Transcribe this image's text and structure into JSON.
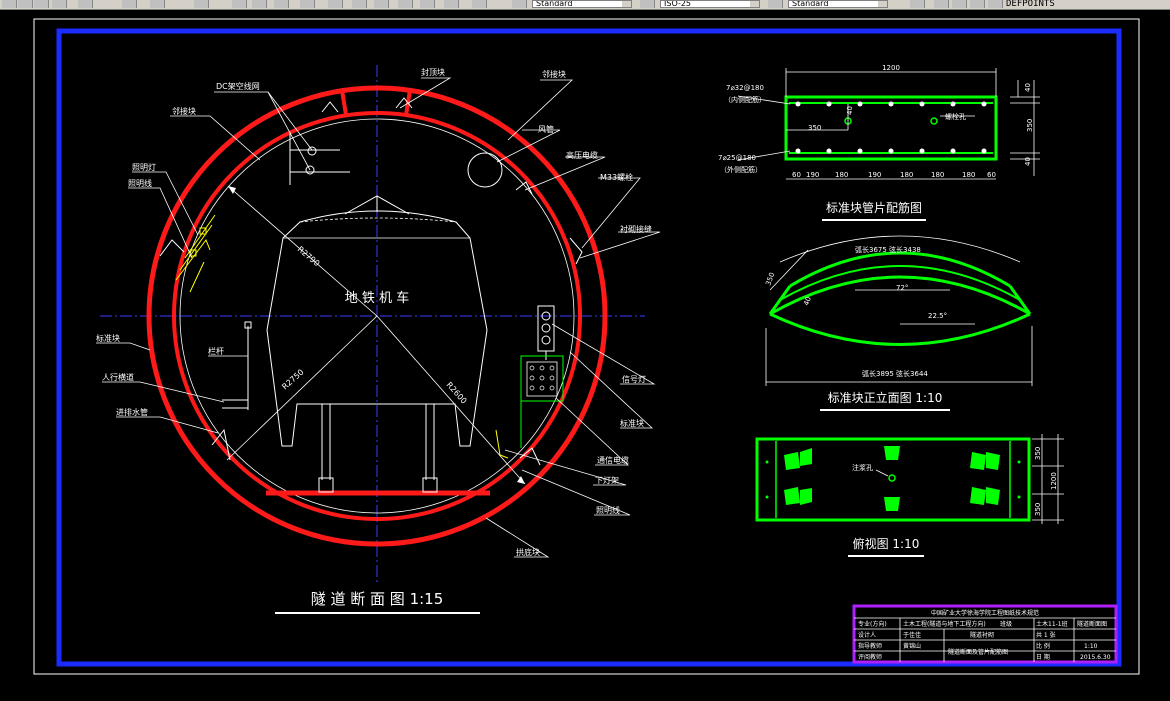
{
  "toolbar": {
    "text_style": "Standard",
    "dim_style": "ISO-25",
    "table_style": "Standard",
    "layer": "DEFPOINTS"
  },
  "drawing": {
    "tunnel": {
      "title": "隧 道 断 面 图 1:15",
      "vehicle": "地 铁 机 车",
      "labels": {
        "dc_net": "DC架空线网",
        "seal_top": "封顶块",
        "adj_top_left": "邻接块",
        "adj_top_right": "邻接块",
        "adj_left": "邻接块",
        "wind_pipe": "风管",
        "hv_cable": "高压电缆",
        "m33": "M33螺栓",
        "lighting_lamp": "照明灯",
        "lighting_line_left": "照明线",
        "lining": "衬砌接缝",
        "std_left": "标准块",
        "railing": "栏杆",
        "walkway": "人行横道",
        "drain": "进排水管",
        "signal": "信号灯",
        "std_right": "标准块",
        "comm_cable": "通信电缆",
        "lamp_rack": "下灯架",
        "lighting_line_right": "照明线",
        "bottom_block": "拱底块",
        "r2790": "R2790",
        "r2750": "R2750",
        "r2600": "R2600"
      }
    },
    "rebar": {
      "title": "标准块管片配筋图",
      "width": "1200",
      "height": "350",
      "d40a": "40",
      "d40b": "40",
      "d40c": "40",
      "d350": "350",
      "inner": "7⌀32@180",
      "inner_note": "（内侧配筋）",
      "outer": "7⌀25@180",
      "outer_note": "（外侧配筋）",
      "bolt": "螺栓孔",
      "bottom_dims": [
        "60",
        "190",
        "180",
        "190",
        "180",
        "180",
        "180",
        "60"
      ]
    },
    "elevation": {
      "title": "标准块正立面图  1:10",
      "top_arc": "弧长3675    弦长3438",
      "bottom_arc": "弧长3895    弦长3644",
      "angle": "72°",
      "angle2": "22.5°",
      "d350": "350",
      "d40": "40"
    },
    "plan": {
      "title": "俯视图  1:10",
      "grout": "注浆孔",
      "d350a": "350",
      "d1200": "1200",
      "d350b": "350"
    },
    "titleblock": {
      "heading": "中国矿业大学徐海学院工程图纸技术规范",
      "r1c1": "专业(方向)",
      "r1c2": "土木工程(隧道与地下工程方向)",
      "r1c3": "班级",
      "r1c4": "土木11-1班",
      "r1c5": "隧道断面图",
      "r2c1": "设计人",
      "r2c2": "于佳佳",
      "r2c3": "隧道衬砌",
      "r2c4": "共 1 张",
      "r3c1": "指导教师",
      "r3c2": "黄锦山",
      "r3c3": "比  例",
      "r3c4": "1:10",
      "r4c1": "评阅教师",
      "r4c2": "隧道断面及管片配筋图",
      "r4c3": "日  期",
      "r4c4": "2015.6.30"
    }
  }
}
